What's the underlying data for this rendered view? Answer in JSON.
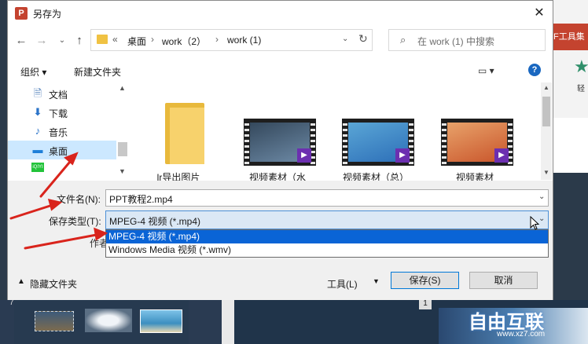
{
  "dialog": {
    "title": "另存为",
    "app_logo_letter": "P",
    "close_glyph": "✕",
    "address": {
      "more": "«",
      "breadcrumbs": [
        "桌面",
        "work（2）",
        "work (1)"
      ],
      "separator": "›"
    },
    "search_placeholder": "在 work (1) 中搜索",
    "toolbar": {
      "organize": "组织 ▾",
      "new_folder": "新建文件夹",
      "help": "?"
    },
    "nav_items": [
      {
        "label": "文档",
        "icon": "document-icon"
      },
      {
        "label": "下载",
        "icon": "download-icon"
      },
      {
        "label": "音乐",
        "icon": "music-icon"
      },
      {
        "label": "桌面",
        "icon": "desktop-icon"
      },
      {
        "label": "",
        "icon": "iqiyi-icon"
      }
    ],
    "iqiyi_text": "iQIYI",
    "files": [
      {
        "name": "lr导出图片",
        "kind": "folder"
      },
      {
        "name": "视频素材（水",
        "kind": "video",
        "colors": [
          "#6d8aa6",
          "#34485c"
        ]
      },
      {
        "name": "视频素材（总）",
        "kind": "video",
        "colors": [
          "#2d6fb8",
          "#5aa6d6"
        ]
      },
      {
        "name": "视频素材",
        "kind": "video",
        "colors": [
          "#c9552b",
          "#e8a26a"
        ]
      }
    ],
    "form": {
      "filename_label": "文件名(N):",
      "filename_value": "PPT教程2.mp4",
      "filetype_label": "保存类型(T):",
      "filetype_value": "MPEG-4 视频 (*.mp4)",
      "filetype_options": [
        "MPEG-4 视频 (*.mp4)",
        "Windows Media 视频 (*.wmv)"
      ],
      "authors_peek": "作者:"
    },
    "footer": {
      "hide_folders": "隐藏文件夹",
      "tools": "工具(L)",
      "save": "保存(S)",
      "cancel": "取消"
    }
  },
  "background": {
    "ribbon_text": "F工具集",
    "ribbon_sub": "轻",
    "slide_numbers": [
      "7",
      "1"
    ],
    "watermark": "自由互联",
    "watermark_url": "www.xz7.com"
  },
  "colors": {
    "accent": "#0a64d6",
    "ppt_red": "#c4432f",
    "annotation_red": "#d9241c"
  }
}
